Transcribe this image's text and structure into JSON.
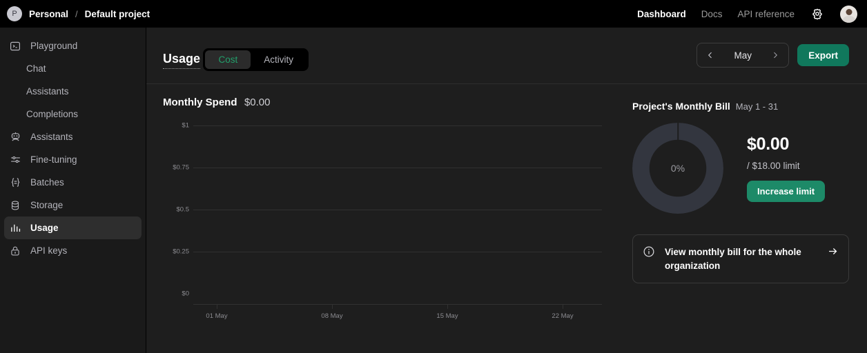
{
  "topbar": {
    "org_initial": "P",
    "org": "Personal",
    "separator": "/",
    "project": "Default project",
    "nav": [
      {
        "label": "Dashboard",
        "active": true
      },
      {
        "label": "Docs",
        "active": false
      },
      {
        "label": "API reference",
        "active": false
      }
    ],
    "gear_icon": "gear-icon",
    "avatar": "user-avatar"
  },
  "sidebar": {
    "items": [
      {
        "label": "Playground",
        "icon": "terminal-icon",
        "sub": false,
        "active": false
      },
      {
        "label": "Chat",
        "icon": "",
        "sub": true,
        "active": false
      },
      {
        "label": "Assistants",
        "icon": "",
        "sub": true,
        "active": false
      },
      {
        "label": "Completions",
        "icon": "",
        "sub": true,
        "active": false
      },
      {
        "label": "Assistants",
        "icon": "robot-icon",
        "sub": false,
        "active": false
      },
      {
        "label": "Fine-tuning",
        "icon": "sliders-icon",
        "sub": false,
        "active": false
      },
      {
        "label": "Batches",
        "icon": "batches-icon",
        "sub": false,
        "active": false
      },
      {
        "label": "Storage",
        "icon": "database-icon",
        "sub": false,
        "active": false
      },
      {
        "label": "Usage",
        "icon": "bar-chart-icon",
        "sub": false,
        "active": true
      },
      {
        "label": "API keys",
        "icon": "lock-icon",
        "sub": false,
        "active": false
      }
    ]
  },
  "usage": {
    "title": "Usage",
    "tabs": [
      {
        "label": "Cost",
        "active": true
      },
      {
        "label": "Activity",
        "active": false
      }
    ],
    "month": "May",
    "prev_icon": "chevron-left-icon",
    "next_icon": "chevron-right-icon",
    "export_label": "Export"
  },
  "spend": {
    "title": "Monthly Spend",
    "amount": "$0.00"
  },
  "bill": {
    "title": "Project's Monthly Bill",
    "range": "May 1 - 31",
    "percent": "0%",
    "amount": "$0.00",
    "limit": "/ $18.00 limit",
    "increase_label": "Increase limit",
    "org_card_text": "View monthly bill for the whole organization",
    "org_card_info_icon": "info-icon",
    "org_card_arrow_icon": "arrow-right-icon"
  },
  "colors": {
    "accent_green": "#10785c",
    "button_green": "#1d8a68",
    "tab_active_text": "#22a06b",
    "sidebar_bg": "#1a1a1a",
    "main_bg": "#1e1e1e",
    "topbar_bg": "#000000",
    "donut_ring": "#33363f",
    "grid": "#313131"
  },
  "chart_data": {
    "type": "line",
    "title": "Monthly Spend",
    "xlabel": "",
    "ylabel": "",
    "x": [
      "01 May",
      "08 May",
      "15 May",
      "22 May"
    ],
    "values": [
      0,
      0,
      0,
      0
    ],
    "ytick_labels": [
      "$1",
      "$0.75",
      "$0.5",
      "$0.25",
      "$0"
    ],
    "ytick_values": [
      1,
      0.75,
      0.5,
      0.25,
      0
    ],
    "ylim": [
      0,
      1
    ],
    "grid": true,
    "legend": "none",
    "series": [
      {
        "name": "Monthly Spend",
        "values": [
          0,
          0,
          0,
          0
        ]
      }
    ]
  }
}
